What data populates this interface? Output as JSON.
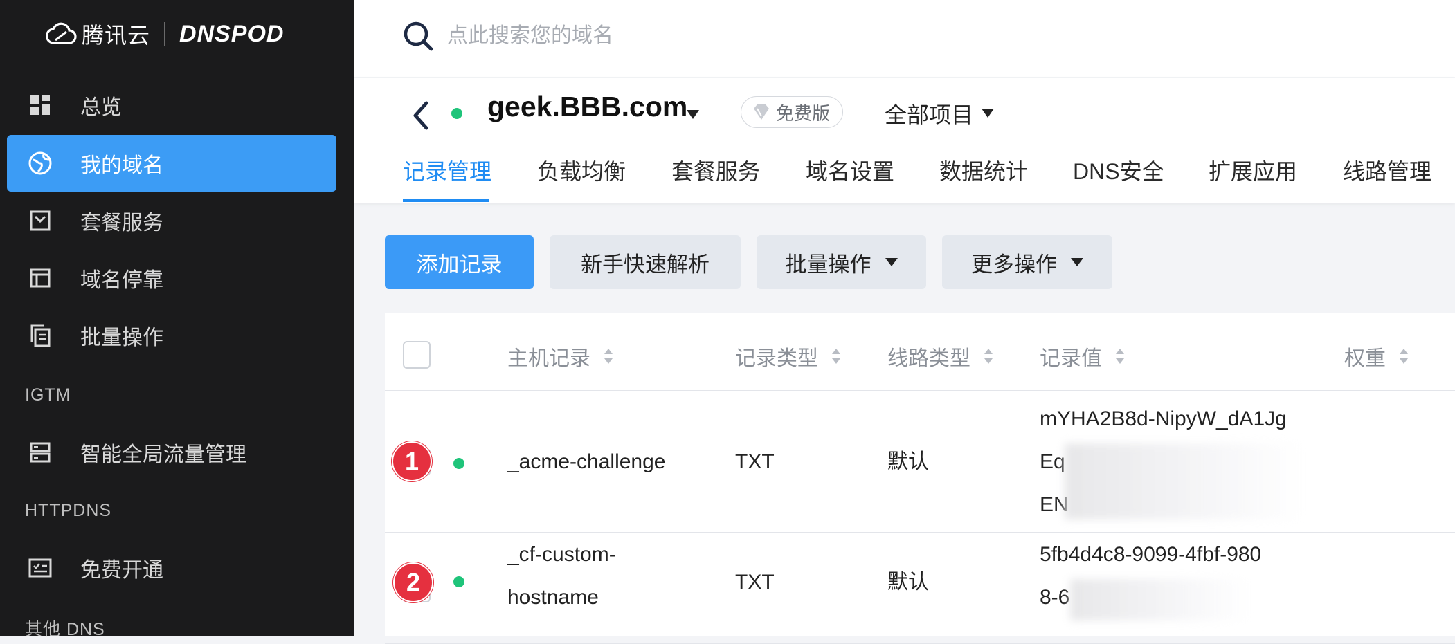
{
  "sidebar": {
    "brand_cn": "腾讯云",
    "brand_en": "DNSPOD",
    "items": [
      {
        "label": "总览"
      },
      {
        "label": "我的域名"
      },
      {
        "label": "套餐服务"
      },
      {
        "label": "域名停靠"
      },
      {
        "label": "批量操作"
      },
      {
        "label": "智能全局流量管理"
      },
      {
        "label": "免费开通"
      }
    ],
    "groups": {
      "igtm": "IGTM",
      "httpdns": "HTTPDNS",
      "other_dns": "其他 DNS"
    }
  },
  "search": {
    "placeholder": "点此搜索您的域名"
  },
  "domain": {
    "name": "geek.BBB.com",
    "plan": "免费版",
    "project": "全部项目",
    "status_color": "#1fc47a"
  },
  "tabs": [
    {
      "label": "记录管理",
      "active": true
    },
    {
      "label": "负载均衡"
    },
    {
      "label": "套餐服务"
    },
    {
      "label": "域名设置"
    },
    {
      "label": "数据统计"
    },
    {
      "label": "DNS安全"
    },
    {
      "label": "扩展应用"
    },
    {
      "label": "线路管理"
    }
  ],
  "toolbar": {
    "add": "添加记录",
    "quick": "新手快速解析",
    "batch": "批量操作",
    "more": "更多操作"
  },
  "table": {
    "headers": {
      "host": "主机记录",
      "type": "记录类型",
      "line": "线路类型",
      "value": "记录值",
      "weight": "权重"
    },
    "rows": [
      {
        "badge": "1",
        "host": "_acme-challenge",
        "type": "TXT",
        "line": "默认",
        "value_lines": [
          "mYHA2B8d-NipyW_dA1Jg",
          "Eq",
          "EN"
        ]
      },
      {
        "badge": "2",
        "host_lines": [
          "_cf-custom-",
          "hostname"
        ],
        "type": "TXT",
        "line": "默认",
        "value_lines": [
          "5fb4d4c8-9099-4fbf-980",
          "8-6"
        ]
      }
    ]
  },
  "colors": {
    "sidebar_bg": "#1b1b1c",
    "accent": "#3c9cf5",
    "tab_active": "#1f8cf3",
    "badge_red": "#e5303f"
  }
}
